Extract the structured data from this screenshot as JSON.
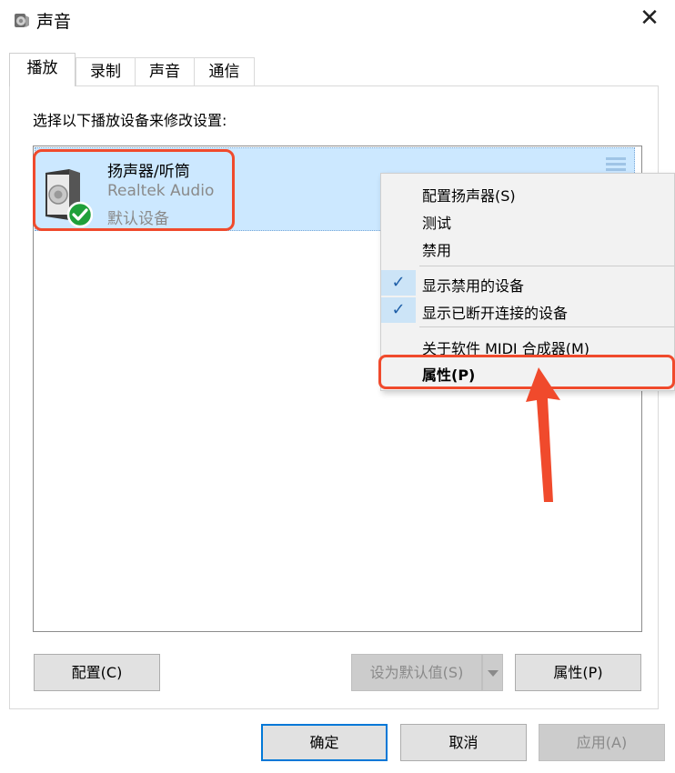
{
  "window": {
    "title": "声音",
    "close_glyph": "✕"
  },
  "tabs": [
    {
      "label": "播放",
      "active": true
    },
    {
      "label": "录制",
      "active": false
    },
    {
      "label": "声音",
      "active": false
    },
    {
      "label": "通信",
      "active": false
    }
  ],
  "instruction": "选择以下播放设备来修改设置:",
  "device": {
    "name": "扬声器/听筒",
    "driver": "Realtek Audio",
    "status": "默认设备",
    "icon": "speaker-icon",
    "default_badge_icon": "check-circle-icon"
  },
  "context_menu": {
    "items": [
      {
        "label": "配置扬声器(S)",
        "checked": false
      },
      {
        "label": "测试",
        "checked": false
      },
      {
        "label": "禁用",
        "checked": false
      },
      {
        "label": "显示禁用的设备",
        "checked": true
      },
      {
        "label": "显示已断开连接的设备",
        "checked": true
      },
      {
        "label": "关于软件 MIDI 合成器(M)",
        "checked": false
      },
      {
        "label": "属性(P)",
        "checked": false,
        "bold": true
      }
    ],
    "check_glyph": "✓"
  },
  "buttons": {
    "configure": "配置(C)",
    "set_default": "设为默认值(S)",
    "properties": "属性(P)",
    "ok": "确定",
    "cancel": "取消",
    "apply": "应用(A)"
  },
  "colors": {
    "selection": "#cce8ff",
    "annotation": "#f04a2c",
    "accent": "#0078d7",
    "badge_green": "#1fa03a"
  }
}
